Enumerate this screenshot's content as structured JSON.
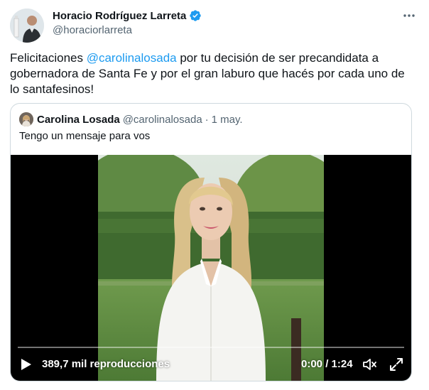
{
  "author": {
    "display_name": "Horacio Rodríguez Larreta",
    "handle": "@horaciorlarreta",
    "avatar_icon": "profile-avatar",
    "verified_icon": "verified-badge-icon",
    "verified_color": "#1d9bf0"
  },
  "tweet": {
    "text_before": "Felicitaciones ",
    "mention": "@carolinalosada",
    "text_after": " por tu decisión de ser precandidata a gobernadora de Santa Fe y por el gran laburo que hacés por cada uno de lo santafesinos!"
  },
  "quote": {
    "display_name": "Carolina Losada",
    "handle": "@carolinalosada",
    "separator": "·",
    "date": "1 may.",
    "text": "Tengo un mensaje para vos"
  },
  "video": {
    "views": "389,7 mil reproducciones",
    "time": "0:00 / 1:24",
    "progress": 0
  },
  "colors": {
    "accent": "#1d9bf0",
    "text": "#0f1419",
    "secondary": "#536471",
    "border": "#cfd9de"
  }
}
